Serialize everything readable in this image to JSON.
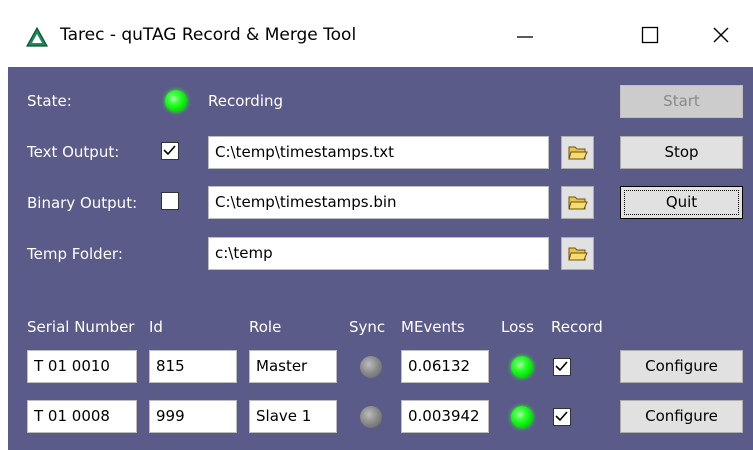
{
  "window": {
    "title": "Tarec - quTAG Record & Merge Tool"
  },
  "colors": {
    "background": "#5b5b8a",
    "led_on": "#22ff22",
    "led_off": "#8c8c8c"
  },
  "state": {
    "label": "State:",
    "value": "Recording",
    "led": "on"
  },
  "text_output": {
    "label": "Text Output:",
    "checked": true,
    "path": "C:\\temp\\timestamps.txt"
  },
  "binary_output": {
    "label": "Binary Output:",
    "checked": false,
    "path": "C:\\temp\\timestamps.bin"
  },
  "temp_folder": {
    "label": "Temp Folder:",
    "path": "c:\\temp"
  },
  "buttons": {
    "start": "Start",
    "stop": "Stop",
    "quit": "Quit"
  },
  "table": {
    "headers": {
      "serial": "Serial Number",
      "id": "Id",
      "role": "Role",
      "sync": "Sync",
      "mevents": "MEvents",
      "loss": "Loss",
      "record": "Record"
    },
    "rows": [
      {
        "serial": "T 01 0010",
        "id": "815",
        "role": "Master",
        "sync": "off",
        "mevents": "0.06132",
        "loss": "on",
        "record": true,
        "configure": "Configure"
      },
      {
        "serial": "T 01 0008",
        "id": "999",
        "role": "Slave 1",
        "sync": "off",
        "mevents": "0.003942",
        "loss": "on",
        "record": true,
        "configure": "Configure"
      }
    ]
  }
}
